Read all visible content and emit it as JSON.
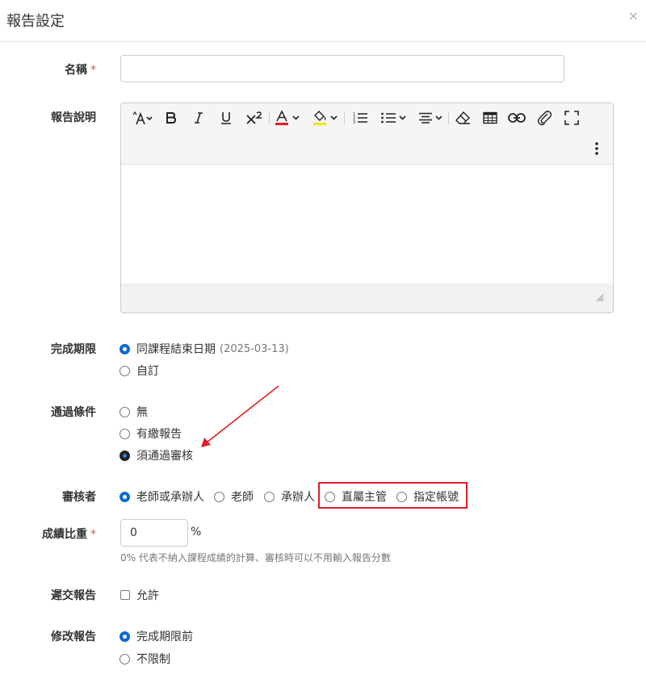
{
  "dialog": {
    "title": "報告設定",
    "close_glyph": "×"
  },
  "name_field": {
    "label": "名稱",
    "required_mark": "*",
    "value": ""
  },
  "description_field": {
    "label": "報告說明",
    "toolbar_icons": [
      "font-size-icon",
      "bold-icon",
      "italic-icon",
      "underline-icon",
      "superscript-icon",
      "font-color-icon",
      "highlight-color-icon",
      "ordered-list-icon",
      "unordered-list-icon",
      "align-icon",
      "eraser-icon",
      "table-icon",
      "link-icon",
      "attachment-icon",
      "fullscreen-icon",
      "more-icon"
    ],
    "font_color": "#e11d26",
    "highlight_color": "#f0e800",
    "content": ""
  },
  "deadline": {
    "label": "完成期限",
    "options": [
      {
        "label": "同課程結束日期",
        "note": "(2025-03-13)",
        "selected": true
      },
      {
        "label": "自訂",
        "selected": false
      }
    ]
  },
  "pass_condition": {
    "label": "通過條件",
    "options": [
      {
        "label": "無",
        "selected": false
      },
      {
        "label": "有繳報告",
        "selected": false
      },
      {
        "label": "須通過審核",
        "selected": true
      }
    ]
  },
  "reviewer": {
    "label": "審核者",
    "options": [
      {
        "label": "老師或承辦人",
        "selected": true
      },
      {
        "label": "老師",
        "selected": false
      },
      {
        "label": "承辦人",
        "selected": false
      },
      {
        "label": "直屬主管",
        "selected": false
      },
      {
        "label": "指定帳號",
        "selected": false
      }
    ]
  },
  "grade_weight": {
    "label": "成績比重",
    "required_mark": "*",
    "value": "0",
    "unit": "%",
    "help": "0% 代表不納入課程成績的計算、審核時可以不用輸入報告分數"
  },
  "late_submission": {
    "label": "遲交報告",
    "checkbox_label": "允許",
    "checked": false
  },
  "modify_report": {
    "label": "修改報告",
    "options": [
      {
        "label": "完成期限前",
        "selected": true
      },
      {
        "label": "不限制",
        "selected": false
      }
    ]
  },
  "annotation_color": "#e11d26",
  "accent_color": "#0b6bd3"
}
